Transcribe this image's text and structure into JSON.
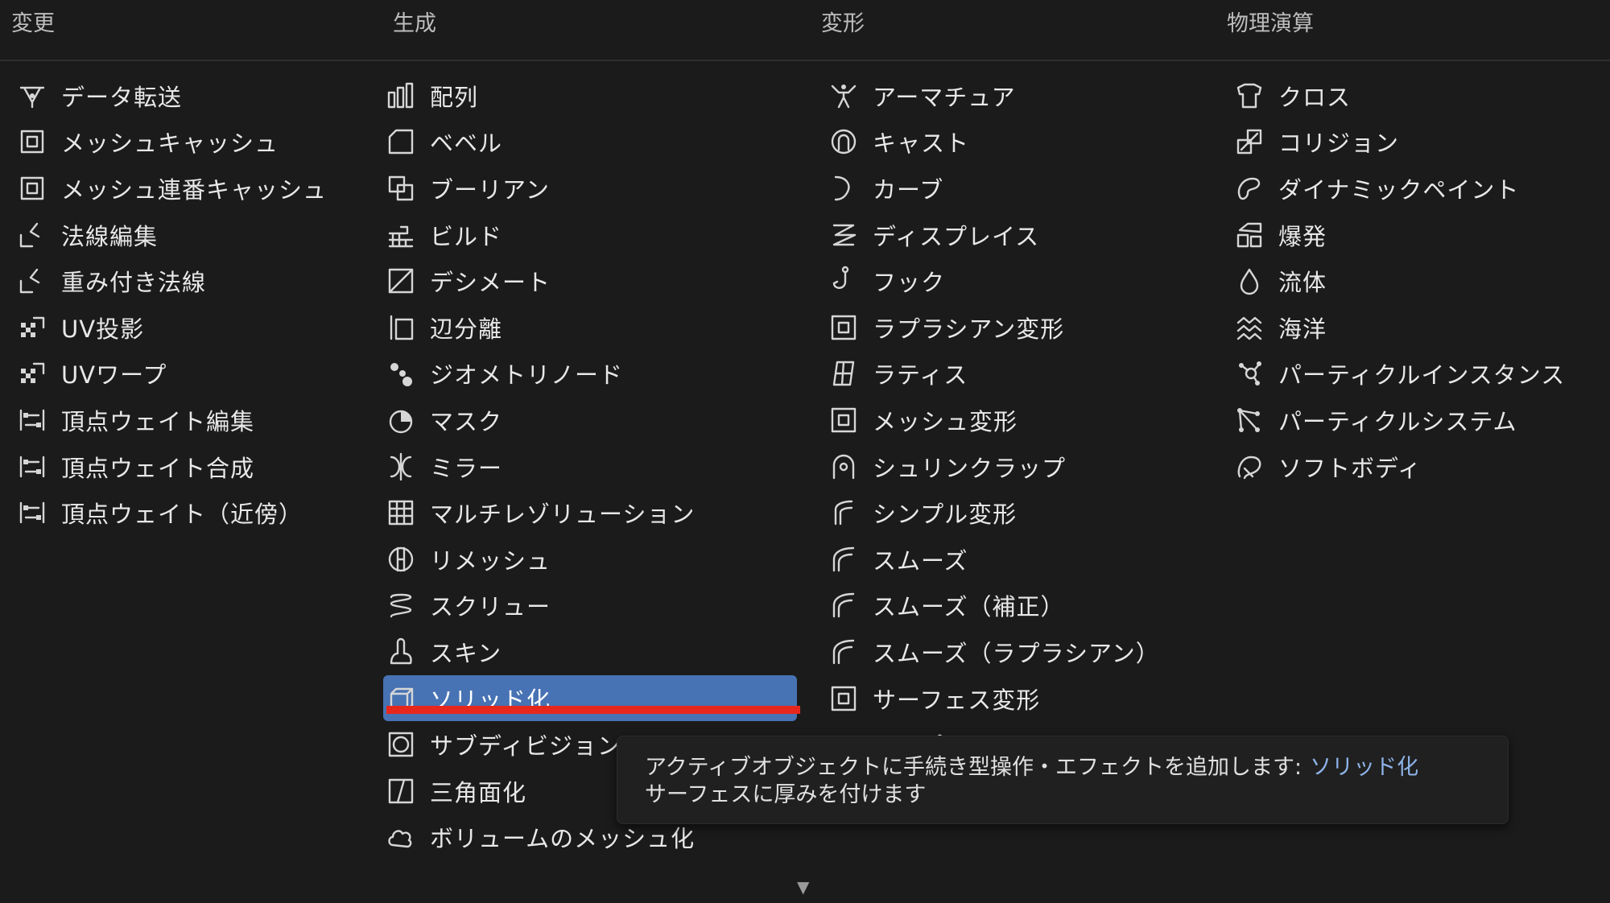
{
  "columns": [
    {
      "header": "変更",
      "items": [
        {
          "label": "データ転送",
          "icon": "data-transfer-icon"
        },
        {
          "label": "メッシュキャッシュ",
          "icon": "mesh-cache-icon"
        },
        {
          "label": "メッシュ連番キャッシュ",
          "icon": "mesh-sequence-cache-icon"
        },
        {
          "label": "法線編集",
          "icon": "normal-edit-icon"
        },
        {
          "label": "重み付き法線",
          "icon": "weighted-normal-icon"
        },
        {
          "label": "UV投影",
          "icon": "uv-project-icon"
        },
        {
          "label": "UVワープ",
          "icon": "uv-warp-icon"
        },
        {
          "label": "頂点ウェイト編集",
          "icon": "vertex-weight-edit-icon"
        },
        {
          "label": "頂点ウェイト合成",
          "icon": "vertex-weight-mix-icon"
        },
        {
          "label": "頂点ウェイト（近傍）",
          "icon": "vertex-weight-proximity-icon"
        }
      ]
    },
    {
      "header": "生成",
      "items": [
        {
          "label": "配列",
          "icon": "array-icon"
        },
        {
          "label": "ベベル",
          "icon": "bevel-icon"
        },
        {
          "label": "ブーリアン",
          "icon": "boolean-icon"
        },
        {
          "label": "ビルド",
          "icon": "build-icon"
        },
        {
          "label": "デシメート",
          "icon": "decimate-icon"
        },
        {
          "label": "辺分離",
          "icon": "edge-split-icon"
        },
        {
          "label": "ジオメトリノード",
          "icon": "geometry-nodes-icon"
        },
        {
          "label": "マスク",
          "icon": "mask-icon"
        },
        {
          "label": "ミラー",
          "icon": "mirror-icon"
        },
        {
          "label": "マルチレゾリューション",
          "icon": "multires-icon"
        },
        {
          "label": "リメッシュ",
          "icon": "remesh-icon"
        },
        {
          "label": "スクリュー",
          "icon": "screw-icon"
        },
        {
          "label": "スキン",
          "icon": "skin-icon"
        },
        {
          "label": "ソリッド化",
          "icon": "solidify-icon",
          "selected": true
        },
        {
          "label": "サブディビジョンサーフェス",
          "icon": "subdivision-icon"
        },
        {
          "label": "三角面化",
          "icon": "triangulate-icon"
        },
        {
          "label": "ボリュームのメッシュ化",
          "icon": "volume-to-mesh-icon"
        }
      ]
    },
    {
      "header": "変形",
      "items": [
        {
          "label": "アーマチュア",
          "icon": "armature-icon"
        },
        {
          "label": "キャスト",
          "icon": "cast-icon"
        },
        {
          "label": "カーブ",
          "icon": "curve-icon"
        },
        {
          "label": "ディスプレイス",
          "icon": "displace-icon"
        },
        {
          "label": "フック",
          "icon": "hook-icon"
        },
        {
          "label": "ラプラシアン変形",
          "icon": "laplacian-deform-icon"
        },
        {
          "label": "ラティス",
          "icon": "lattice-icon"
        },
        {
          "label": "メッシュ変形",
          "icon": "mesh-deform-icon"
        },
        {
          "label": "シュリンクラップ",
          "icon": "shrinkwrap-icon"
        },
        {
          "label": "シンプル変形",
          "icon": "simple-deform-icon"
        },
        {
          "label": "スムーズ",
          "icon": "smooth-icon"
        },
        {
          "label": "スムーズ（補正）",
          "icon": "smooth-corrective-icon"
        },
        {
          "label": "スムーズ（ラプラシアン）",
          "icon": "smooth-laplacian-icon"
        },
        {
          "label": "サーフェス変形",
          "icon": "surface-deform-icon"
        },
        {
          "label": "ワープ",
          "icon": "warp-icon"
        }
      ]
    },
    {
      "header": "物理演算",
      "items": [
        {
          "label": "クロス",
          "icon": "cloth-icon"
        },
        {
          "label": "コリジョン",
          "icon": "collision-icon"
        },
        {
          "label": "ダイナミックペイント",
          "icon": "dynamic-paint-icon"
        },
        {
          "label": "爆発",
          "icon": "explode-icon"
        },
        {
          "label": "流体",
          "icon": "fluid-icon"
        },
        {
          "label": "海洋",
          "icon": "ocean-icon"
        },
        {
          "label": "パーティクルインスタンス",
          "icon": "particle-instance-icon"
        },
        {
          "label": "パーティクルシステム",
          "icon": "particle-system-icon"
        },
        {
          "label": "ソフトボディ",
          "icon": "soft-body-icon"
        }
      ]
    }
  ],
  "tooltip": {
    "line1_prefix": "アクティブオブジェクトに手続き型操作・エフェクトを追加します:",
    "line1_accent": "ソリッド化",
    "line2": "サーフェスに厚みを付けます"
  },
  "colors": {
    "background": "#1b1b1b",
    "selected": "#4772b3",
    "annotation_underline": "#e8271c",
    "tooltip_accent": "#8db3e8"
  },
  "more_indicator": "▼"
}
